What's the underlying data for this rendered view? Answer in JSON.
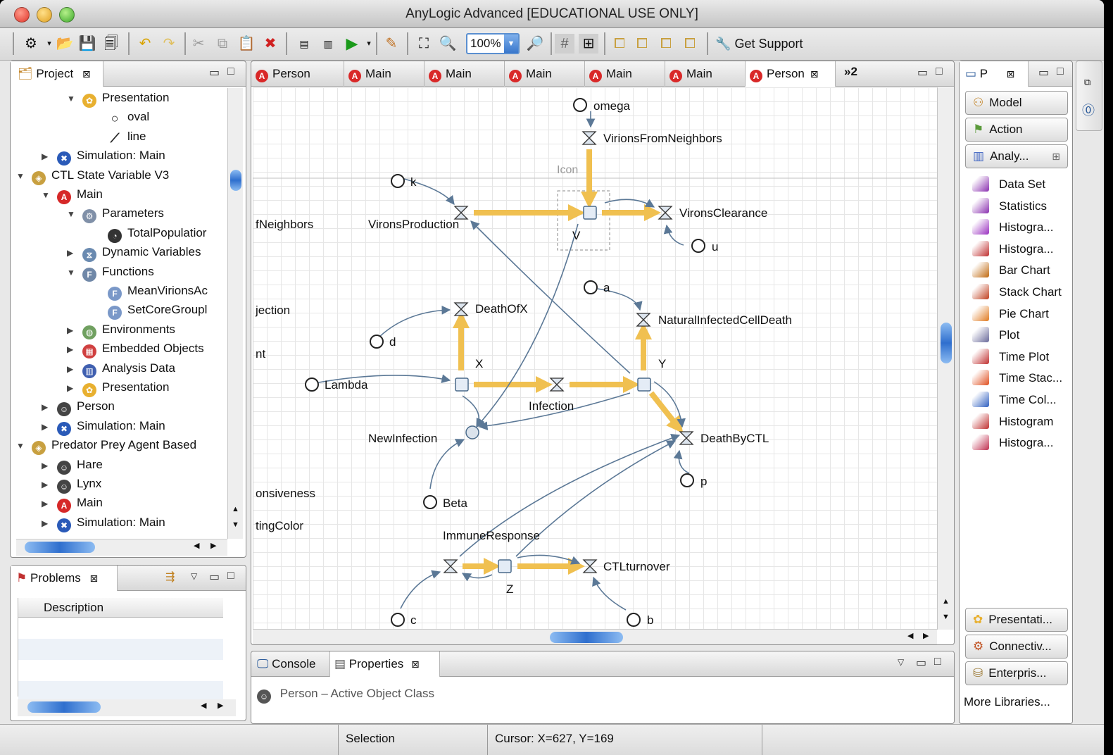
{
  "window": {
    "title": "AnyLogic Advanced [EDUCATIONAL USE ONLY]"
  },
  "toolbar": {
    "zoom": "100%",
    "support_label": "Get Support"
  },
  "project_panel": {
    "tab_label": "Project",
    "tree": [
      {
        "label": "Presentation",
        "indent": 4,
        "arrow": "open",
        "icon": "presentation"
      },
      {
        "label": "oval",
        "indent": 6,
        "arrow": "",
        "icon": "oval"
      },
      {
        "label": "line",
        "indent": 6,
        "arrow": "",
        "icon": "line"
      },
      {
        "label": "Simulation: Main",
        "indent": 2,
        "arrow": "closed",
        "icon": "simulation"
      },
      {
        "label": "CTL State Variable V3",
        "indent": 0,
        "arrow": "open",
        "icon": "model"
      },
      {
        "label": "Main",
        "indent": 2,
        "arrow": "open",
        "icon": "active"
      },
      {
        "label": "Parameters",
        "indent": 4,
        "arrow": "open",
        "icon": "parameters"
      },
      {
        "label": "TotalPopulatior",
        "indent": 6,
        "arrow": "",
        "icon": "param"
      },
      {
        "label": "Dynamic Variables",
        "indent": 4,
        "arrow": "closed",
        "icon": "dynvars"
      },
      {
        "label": "Functions",
        "indent": 4,
        "arrow": "open",
        "icon": "functions"
      },
      {
        "label": "MeanVirionsAc",
        "indent": 6,
        "arrow": "",
        "icon": "function"
      },
      {
        "label": "SetCoreGroupl",
        "indent": 6,
        "arrow": "",
        "icon": "function"
      },
      {
        "label": "Environments",
        "indent": 4,
        "arrow": "closed",
        "icon": "environments"
      },
      {
        "label": "Embedded Objects",
        "indent": 4,
        "arrow": "closed",
        "icon": "embedded"
      },
      {
        "label": "Analysis Data",
        "indent": 4,
        "arrow": "closed",
        "icon": "analysis"
      },
      {
        "label": "Presentation",
        "indent": 4,
        "arrow": "closed",
        "icon": "presentation"
      },
      {
        "label": "Person",
        "indent": 2,
        "arrow": "closed",
        "icon": "agent"
      },
      {
        "label": "Simulation: Main",
        "indent": 2,
        "arrow": "closed",
        "icon": "simulation"
      },
      {
        "label": "Predator Prey Agent Based",
        "indent": 0,
        "arrow": "open",
        "icon": "model"
      },
      {
        "label": "Hare",
        "indent": 2,
        "arrow": "closed",
        "icon": "agent"
      },
      {
        "label": "Lynx",
        "indent": 2,
        "arrow": "closed",
        "icon": "agent"
      },
      {
        "label": "Main",
        "indent": 2,
        "arrow": "closed",
        "icon": "active"
      },
      {
        "label": "Simulation: Main",
        "indent": 2,
        "arrow": "closed",
        "icon": "simulation"
      }
    ]
  },
  "problems_panel": {
    "tab_label": "Problems",
    "column": "Description"
  },
  "editor_tabs": [
    {
      "label": "Person",
      "active": false
    },
    {
      "label": "Main",
      "active": false
    },
    {
      "label": "Main",
      "active": false
    },
    {
      "label": "Main",
      "active": false
    },
    {
      "label": "Main",
      "active": false
    },
    {
      "label": "Main",
      "active": false
    },
    {
      "label": "Person",
      "active": true
    }
  ],
  "editor_overflow": "»2",
  "diagram": {
    "icon_label": "Icon",
    "stocks": [
      "V",
      "X",
      "Y",
      "Z"
    ],
    "flows": [
      "VirionsFromNeighbors",
      "VironsProduction",
      "VironsClearance",
      "DeathOfX",
      "NaturalInfectedCellDeath",
      "Infection",
      "DeathByCTL",
      "ImmuneResponse",
      "CTLturnover"
    ],
    "parameters": [
      "omega",
      "k",
      "u",
      "a",
      "d",
      "Lambda",
      "Beta",
      "p",
      "c",
      "b"
    ],
    "dynamic_variables": [
      "NewInfection"
    ],
    "clipped_labels": [
      "fNeighbors",
      "jection",
      "nt",
      "onsiveness",
      "tingColor"
    ]
  },
  "bottom_panel": {
    "tabs": [
      "Console",
      "Properties"
    ],
    "properties_title": "Person – Active Object Class"
  },
  "palette": {
    "tab_label": "P",
    "buttons": [
      "Model",
      "Action",
      "Analy..."
    ],
    "items": [
      "Data Set",
      "Statistics",
      "Histogra...",
      "Histogra...",
      "Bar Chart",
      "Stack Chart",
      "Pie Chart",
      "Plot",
      "Time Plot",
      "Time Stac...",
      "Time Col...",
      "Histogram",
      "Histogra..."
    ],
    "bottom_buttons": [
      "Presentati...",
      "Connectiv...",
      "Enterpris..."
    ],
    "more_libraries": "More Libraries..."
  },
  "statusbar": {
    "mode": "Selection",
    "cursor": "Cursor: X=627, Y=169"
  },
  "colors": {
    "flow_arrow": "#f0c050",
    "link": "#5b7896",
    "selection_blue": "#3a78cc"
  }
}
